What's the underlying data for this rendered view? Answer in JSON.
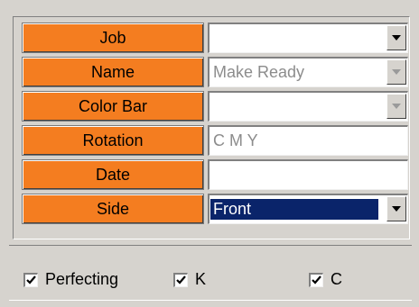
{
  "form": {
    "rows": [
      {
        "label": "Job",
        "value": "",
        "has_dropdown": true,
        "disabled": false,
        "selected": false
      },
      {
        "label": "Name",
        "value": "Make Ready",
        "has_dropdown": true,
        "disabled": true,
        "selected": false
      },
      {
        "label": "Color Bar",
        "value": "",
        "has_dropdown": true,
        "disabled": true,
        "selected": false
      },
      {
        "label": "Rotation",
        "value": "C M Y",
        "has_dropdown": false,
        "disabled": true,
        "selected": false
      },
      {
        "label": "Date",
        "value": "",
        "has_dropdown": false,
        "disabled": false,
        "selected": false
      },
      {
        "label": "Side",
        "value": "Front",
        "has_dropdown": true,
        "disabled": false,
        "selected": true
      }
    ]
  },
  "options": {
    "perfecting": {
      "label": "Perfecting",
      "checked": true
    },
    "k": {
      "label": "K",
      "checked": true
    },
    "c": {
      "label": "C",
      "checked": true
    }
  },
  "colors": {
    "label_bg": "#f47d20",
    "selection_bg": "#0a246a",
    "window_bg": "#d6d3ce"
  },
  "icons": {
    "dropdown": "chevron-down-icon",
    "check": "checkmark-icon"
  }
}
